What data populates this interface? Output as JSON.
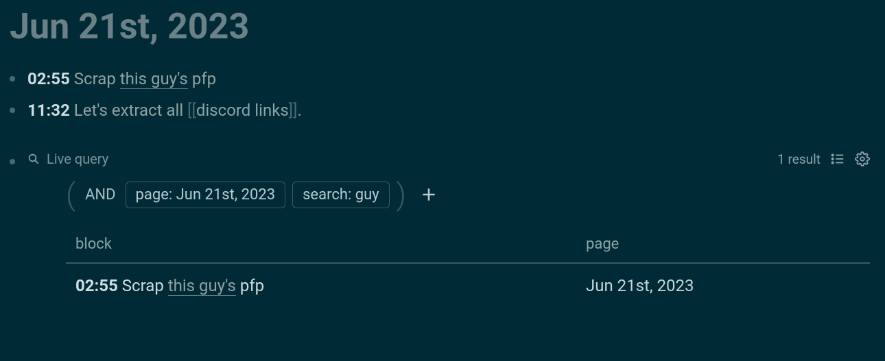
{
  "page_title": "Jun 21st, 2023",
  "blocks": [
    {
      "time": "02:55",
      "pre": " Scrap ",
      "link": "this guy's",
      "post": " pfp"
    },
    {
      "time": "11:32",
      "pre": " Let's extract all ",
      "bracket_open": "[[",
      "page_ref": "discord links",
      "bracket_close": "]]",
      "post": "."
    }
  ],
  "query": {
    "label": "Live query",
    "result_count": "1 result",
    "operator": "AND",
    "filters": [
      "page: Jun 21st, 2023",
      "search: guy"
    ],
    "headers": {
      "block": "block",
      "page": "page"
    },
    "rows": [
      {
        "time": "02:55",
        "pre": " Scrap ",
        "link": "this guy's",
        "post": " pfp",
        "page": "Jun 21st, 2023"
      }
    ]
  }
}
